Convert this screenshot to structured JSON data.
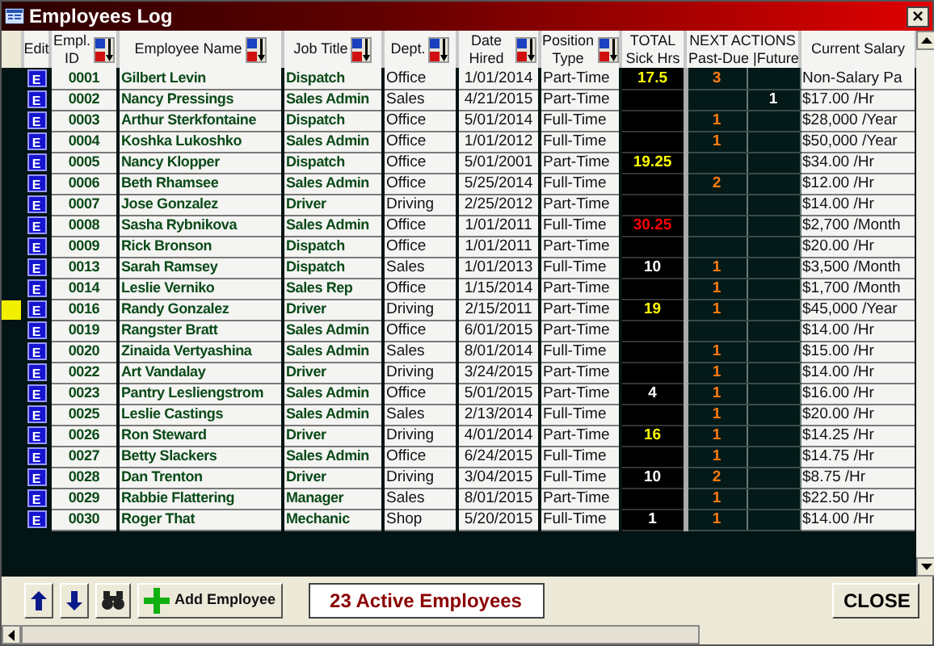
{
  "window": {
    "title": "Employees Log",
    "close": "×"
  },
  "columns": [
    {
      "label": "Edit",
      "sortable": false
    },
    {
      "label": "Empl. ID",
      "sortable": true
    },
    {
      "label": "Employee Name",
      "sortable": true
    },
    {
      "label": "Job Title",
      "sortable": true
    },
    {
      "label": "Dept.",
      "sortable": true
    },
    {
      "label": "Date Hired",
      "sortable": true
    },
    {
      "label": "Position Type",
      "sortable": true
    },
    {
      "label": "TOTAL Sick Hrs",
      "sortable": false
    }
  ],
  "next_actions": {
    "title": "NEXT ACTIONS",
    "past_due": "Past-Due |",
    "future": "Future"
  },
  "salary_column": "Current Salary",
  "rows": [
    {
      "selected": false,
      "edit": "E",
      "id": "0001",
      "name": "Gilbert Levin",
      "job": "Dispatch",
      "dept": "Office",
      "hired": "1/01/2014",
      "position": "Part-Time",
      "sick": "17.5",
      "color": "#ffff00",
      "past_due": "3",
      "salary": "Non-Salary Pa"
    },
    {
      "selected": false,
      "edit": "E",
      "id": "0002",
      "name": "Nancy Pressings",
      "job": "Sales Admin",
      "dept": "Sales",
      "hired": "4/21/2015",
      "position": "Part-Time",
      "future": "1",
      "salary": "$17.00 /Hr"
    },
    {
      "selected": false,
      "edit": "E",
      "id": "0003",
      "name": "Arthur Sterkfontaine",
      "job": "Dispatch",
      "dept": "Office",
      "hired": "5/01/2014",
      "position": "Full-Time",
      "past_due": "1",
      "salary": "$28,000 /Year"
    },
    {
      "selected": false,
      "edit": "E",
      "id": "0004",
      "name": "Koshka Lukoshko",
      "job": "Sales Admin",
      "dept": "Office",
      "hired": "1/01/2012",
      "position": "Full-Time",
      "past_due": "1",
      "salary": "$50,000 /Year"
    },
    {
      "selected": false,
      "edit": "E",
      "id": "0005",
      "name": "Nancy Klopper",
      "job": "Dispatch",
      "dept": "Office",
      "hired": "5/01/2001",
      "position": "Part-Time",
      "sick": "19.25",
      "color": "#ffff00",
      "salary": "$34.00 /Hr"
    },
    {
      "selected": false,
      "edit": "E",
      "id": "0006",
      "name": "Beth Rhamsee",
      "job": "Sales Admin",
      "dept": "Office",
      "hired": "5/25/2014",
      "position": "Full-Time",
      "past_due": "2",
      "salary": "$12.00 /Hr"
    },
    {
      "selected": false,
      "edit": "E",
      "id": "0007",
      "name": "Jose Gonzalez",
      "job": "Driver",
      "dept": "Driving",
      "hired": "2/25/2012",
      "position": "Part-Time",
      "salary": "$14.00 /Hr"
    },
    {
      "selected": false,
      "edit": "E",
      "id": "0008",
      "name": "Sasha Rybnikova",
      "job": "Sales Admin",
      "dept": "Office",
      "hired": "1/01/2011",
      "position": "Full-Time",
      "sick": "30.25",
      "color": "#ff0000",
      "salary": "$2,700 /Month"
    },
    {
      "selected": false,
      "edit": "E",
      "id": "0009",
      "name": "Rick Bronson",
      "job": "Dispatch",
      "dept": "Office",
      "hired": "1/01/2011",
      "position": "Part-Time",
      "salary": "$20.00 /Hr"
    },
    {
      "selected": false,
      "edit": "E",
      "id": "0013",
      "name": "Sarah Ramsey",
      "job": "Dispatch",
      "dept": "Sales",
      "hired": "1/01/2013",
      "position": "Full-Time",
      "sick": "10",
      "color": "#ffffff",
      "past_due": "1",
      "salary": "$3,500 /Month"
    },
    {
      "selected": false,
      "edit": "E",
      "id": "0014",
      "name": "Leslie Verniko",
      "job": "Sales Rep",
      "dept": "Office",
      "hired": "1/15/2014",
      "position": "Part-Time",
      "past_due": "1",
      "salary": "$1,700 /Month"
    },
    {
      "selected": true,
      "edit": "E",
      "id": "0016",
      "name": "Randy Gonzalez",
      "job": "Driver",
      "dept": "Driving",
      "hired": "2/15/2011",
      "position": "Part-Time",
      "sick": "19",
      "color": "#ffff00",
      "past_due": "1",
      "salary": "$45,000 /Year"
    },
    {
      "selected": false,
      "edit": "E",
      "id": "0019",
      "name": "Rangster Bratt",
      "job": "Sales Admin",
      "dept": "Office",
      "hired": "6/01/2015",
      "position": "Part-Time",
      "salary": "$14.00 /Hr"
    },
    {
      "selected": false,
      "edit": "E",
      "id": "0020",
      "name": "Zinaida Vertyashina",
      "job": "Sales Admin",
      "dept": "Sales",
      "hired": "8/01/2014",
      "position": "Full-Time",
      "past_due": "1",
      "salary": "$15.00 /Hr"
    },
    {
      "selected": false,
      "edit": "E",
      "id": "0022",
      "name": "Art Vandalay",
      "job": "Driver",
      "dept": "Driving",
      "hired": "3/24/2015",
      "position": "Part-Time",
      "past_due": "1",
      "salary": "$14.00 /Hr"
    },
    {
      "selected": false,
      "edit": "E",
      "id": "0023",
      "name": "Pantry Lesliengstrom",
      "job": "Sales Admin",
      "dept": "Office",
      "hired": "5/01/2015",
      "position": "Part-Time",
      "sick": "4",
      "color": "#ffffff",
      "past_due": "1",
      "salary": "$16.00 /Hr"
    },
    {
      "selected": false,
      "edit": "E",
      "id": "0025",
      "name": "Leslie Castings",
      "job": "Sales Admin",
      "dept": "Sales",
      "hired": "2/13/2014",
      "position": "Full-Time",
      "past_due": "1",
      "salary": "$20.00 /Hr"
    },
    {
      "selected": false,
      "edit": "E",
      "id": "0026",
      "name": "Ron Steward",
      "job": "Driver",
      "dept": "Driving",
      "hired": "4/01/2014",
      "position": "Part-Time",
      "sick": "16",
      "color": "#ffff00",
      "past_due": "1",
      "salary": "$14.25 /Hr"
    },
    {
      "selected": false,
      "edit": "E",
      "id": "0027",
      "name": "Betty Slackers",
      "job": "Sales Admin",
      "dept": "Office",
      "hired": "6/24/2015",
      "position": "Full-Time",
      "past_due": "1",
      "salary": "$14.75 /Hr"
    },
    {
      "selected": false,
      "edit": "E",
      "id": "0028",
      "name": "Dan Trenton",
      "job": "Driver",
      "dept": "Driving",
      "hired": "3/04/2015",
      "position": "Full-Time",
      "sick": "10",
      "color": "#ffffff",
      "past_due": "2",
      "salary": "$8.75 /Hr"
    },
    {
      "selected": false,
      "edit": "E",
      "id": "0029",
      "name": "Rabbie Flattering",
      "job": "Manager",
      "dept": "Sales",
      "hired": "8/01/2015",
      "position": "Part-Time",
      "past_due": "1",
      "salary": "$22.50 /Hr"
    },
    {
      "selected": false,
      "edit": "E",
      "id": "0030",
      "name": "Roger That",
      "job": "Mechanic",
      "dept": "Shop",
      "hired": "5/20/2015",
      "position": "Full-Time",
      "sick": "1",
      "color": "#ffffff",
      "past_due": "1",
      "salary": "$14.00 /Hr"
    }
  ],
  "footer": {
    "add_button": "Add Employee",
    "count": "23 Active Employees",
    "close_button": "CLOSE"
  }
}
